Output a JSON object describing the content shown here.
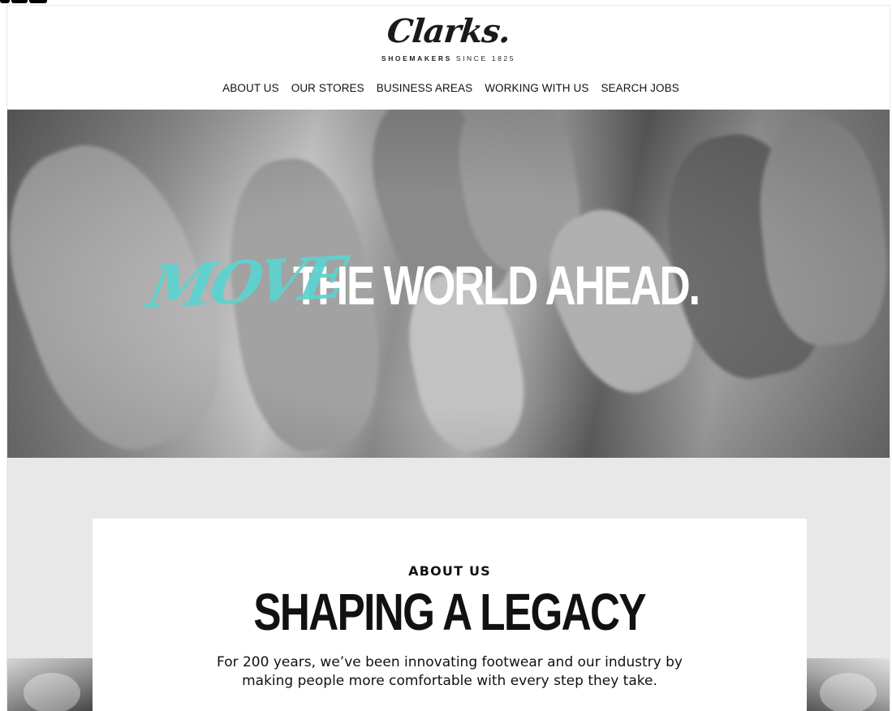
{
  "header": {
    "logo_text": "Clarks.",
    "logo_sub_bold": "SHOEMAKERS",
    "logo_sub_rest": " SINCE 1825",
    "nav": [
      {
        "label": "ABOUT US"
      },
      {
        "label": "OUR STORES"
      },
      {
        "label": "BUSINESS AREAS"
      },
      {
        "label": "WORKING WITH US"
      },
      {
        "label": "SEARCH JOBS"
      }
    ]
  },
  "hero": {
    "tagline_script": "MOVE",
    "tagline_main": "THE WORLD AHEAD.",
    "accent_color": "#5ed3cf"
  },
  "about": {
    "eyebrow": "ABOUT US",
    "title": "SHAPING A LEGACY",
    "body": "For 200 years, we’ve been innovating footwear and our industry by making people more comfortable with every step they take."
  }
}
